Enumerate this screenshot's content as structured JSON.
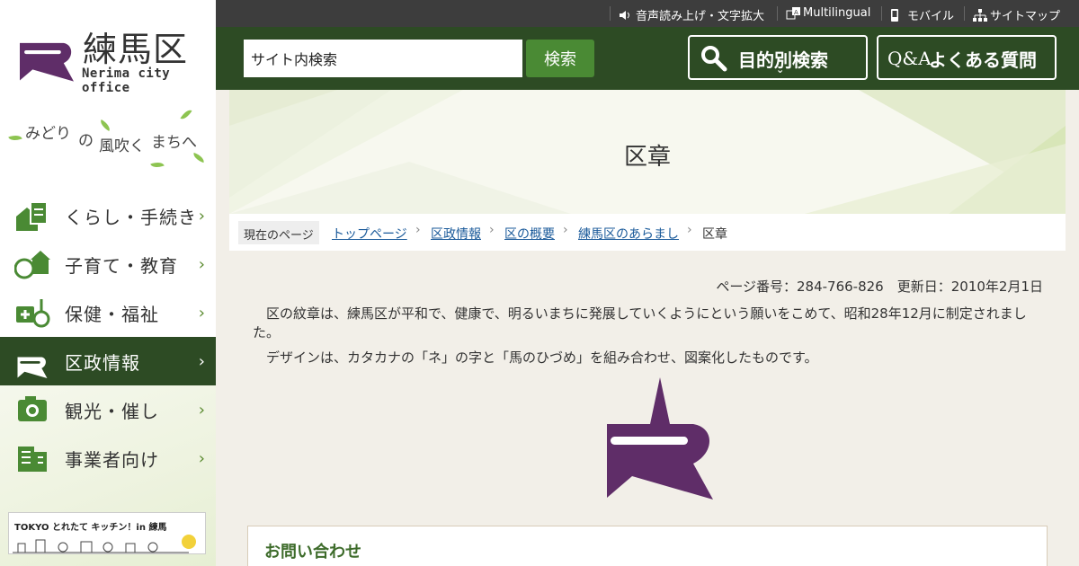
{
  "sidebar": {
    "logo_name": "練馬区",
    "logo_sub": "Nerima city office",
    "slogan": {
      "a": "みどり",
      "b": "の",
      "c": "風吹く",
      "d": "まちへ"
    },
    "items": [
      {
        "label": "くらし・手続き",
        "icon": "house-document-icon"
      },
      {
        "label": "子育て・教育",
        "icon": "child-school-icon"
      },
      {
        "label": "保健・福祉",
        "icon": "medical-wheelchair-icon"
      },
      {
        "label": "区政情報",
        "icon": "ward-emblem-icon"
      },
      {
        "label": "観光・催し",
        "icon": "camera-icon"
      },
      {
        "label": "事業者向け",
        "icon": "building-icon"
      }
    ],
    "banner": "TOKYO とれたて キッチン！in 練馬"
  },
  "topbar": {
    "voice": "音声読み上げ・文字拡大",
    "multilingual": "Multilingual",
    "mobile": "モバイル",
    "sitemap": "サイトマップ"
  },
  "header": {
    "search_value": "サイト内検索",
    "search_button": "検索",
    "purpose_search": "目的別検索",
    "faq_prefix": "Q&A",
    "faq": "よくある質問"
  },
  "page": {
    "title": "区章",
    "breadcrumb_label": "現在のページ",
    "breadcrumbs": [
      "トップページ",
      "区政情報",
      "区の概要",
      "練馬区のあらまし"
    ],
    "breadcrumb_current": "区章",
    "meta": "ページ番号：284-766-826　更新日：2010年2月1日",
    "para1": "区の紋章は、練馬区が平和で、健康で、明るいまちに発展していくようにという願いをこめて、昭和28年12月に制定されました。",
    "para2": "デザインは、カタカナの「ネ」の字と「馬のひづめ」を組み合わせ、図案化したものです。",
    "contact_title": "お問い合わせ"
  },
  "colors": {
    "brand_green": "#2d4b24",
    "button_green": "#4a8a34",
    "emblem_purple": "#5f2d68",
    "link_blue": "#1a5a9a"
  }
}
